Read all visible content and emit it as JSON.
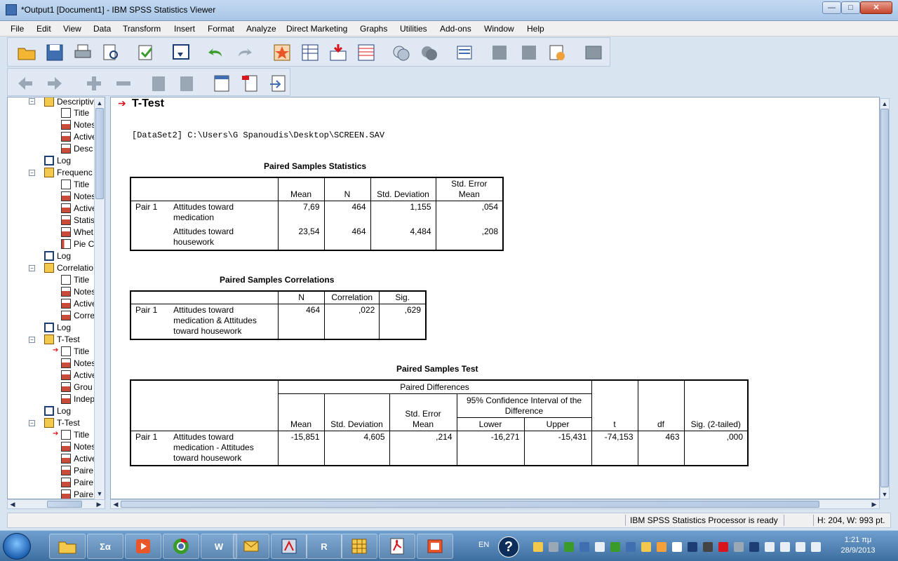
{
  "window": {
    "title": "*Output1 [Document1] - IBM SPSS Statistics Viewer",
    "minimize": "—",
    "maximize": "□",
    "close": "✕"
  },
  "menu": [
    "File",
    "Edit",
    "View",
    "Data",
    "Transform",
    "Insert",
    "Format",
    "Analyze",
    "Direct Marketing",
    "Graphs",
    "Utilities",
    "Add-ons",
    "Window",
    "Help"
  ],
  "outline": {
    "items": [
      {
        "label": "Descriptiv",
        "icon": "book-icon"
      },
      {
        "label": "Title",
        "icon": "doc-icon"
      },
      {
        "label": "Notes",
        "icon": "table-icon"
      },
      {
        "label": "Active",
        "icon": "table-icon"
      },
      {
        "label": "Desc",
        "icon": "table-icon"
      },
      {
        "label": "Log",
        "icon": "log-icon"
      },
      {
        "label": "Frequenc",
        "icon": "book-icon"
      },
      {
        "label": "Title",
        "icon": "doc-icon"
      },
      {
        "label": "Notes",
        "icon": "table-icon"
      },
      {
        "label": "Active",
        "icon": "table-icon"
      },
      {
        "label": "Statis",
        "icon": "table-icon"
      },
      {
        "label": "Whet",
        "icon": "table-icon"
      },
      {
        "label": "Pie C",
        "icon": "chart-icon"
      },
      {
        "label": "Log",
        "icon": "log-icon"
      },
      {
        "label": "Correlatio",
        "icon": "book-icon"
      },
      {
        "label": "Title",
        "icon": "doc-icon"
      },
      {
        "label": "Notes",
        "icon": "table-icon"
      },
      {
        "label": "Active",
        "icon": "table-icon"
      },
      {
        "label": "Corre",
        "icon": "table-icon"
      },
      {
        "label": "Log",
        "icon": "log-icon"
      },
      {
        "label": "T-Test",
        "icon": "book-icon"
      },
      {
        "label": "Title",
        "icon": "doc-icon"
      },
      {
        "label": "Notes",
        "icon": "table-icon"
      },
      {
        "label": "Active",
        "icon": "table-icon"
      },
      {
        "label": "Grou",
        "icon": "table-icon"
      },
      {
        "label": "Indep",
        "icon": "table-icon"
      },
      {
        "label": "Log",
        "icon": "log-icon"
      },
      {
        "label": "T-Test",
        "icon": "book-icon"
      },
      {
        "label": "Title",
        "icon": "doc-icon"
      },
      {
        "label": "Notes",
        "icon": "table-icon"
      },
      {
        "label": "Active",
        "icon": "table-icon"
      },
      {
        "label": "Paire",
        "icon": "table-icon"
      },
      {
        "label": "Paire",
        "icon": "table-icon"
      },
      {
        "label": "Paire",
        "icon": "table-icon"
      }
    ]
  },
  "output": {
    "heading": "T-Test",
    "dataset": "[DataSet2] C:\\Users\\G Spanoudis\\Desktop\\SCREEN.SAV",
    "stats": {
      "caption": "Paired Samples Statistics",
      "headers": {
        "mean": "Mean",
        "n": "N",
        "sd": "Std. Deviation",
        "se": "Std. Error Mean"
      },
      "pair": "Pair 1",
      "rows": [
        {
          "label": "Attitudes toward medication",
          "mean": "7,69",
          "n": "464",
          "sd": "1,155",
          "se": ",054"
        },
        {
          "label": "Attitudes toward housework",
          "mean": "23,54",
          "n": "464",
          "sd": "4,484",
          "se": ",208"
        }
      ]
    },
    "corr": {
      "caption": "Paired Samples Correlations",
      "headers": {
        "n": "N",
        "corr": "Correlation",
        "sig": "Sig."
      },
      "pair": "Pair 1",
      "label": "Attitudes toward medication & Attitudes toward housework",
      "n": "464",
      "corr_value": ",022",
      "sig": ",629"
    },
    "test": {
      "caption": "Paired Samples Test",
      "headers": {
        "paired_diff": "Paired Differences",
        "mean": "Mean",
        "sd": "Std. Deviation",
        "se": "Std. Error Mean",
        "ci": "95% Confidence Interval of the Difference",
        "lower": "Lower",
        "upper": "Upper",
        "t": "t",
        "df": "df",
        "sig": "Sig. (2-tailed)"
      },
      "pair": "Pair 1",
      "label": "Attitudes toward medication - Attitudes toward housework",
      "mean": "-15,851",
      "sd": "4,605",
      "se": ",214",
      "lower": "-16,271",
      "upper": "-15,431",
      "t": "-74,153",
      "df": "463",
      "sig": ",000"
    }
  },
  "status": {
    "processor": "IBM SPSS Statistics Processor is ready",
    "size": "H: 204, W: 993 pt."
  },
  "taskbar": {
    "lang": "EN",
    "help": "?",
    "time": "1:21 πμ",
    "date": "28/9/2013",
    "app_labels": {
      "r": "R",
      "word": "W",
      "calc": "Σα"
    }
  },
  "colors": {
    "accent": "#d8141c",
    "title_bar": "#b8d1ee",
    "taskbar": "#4a7db0"
  }
}
